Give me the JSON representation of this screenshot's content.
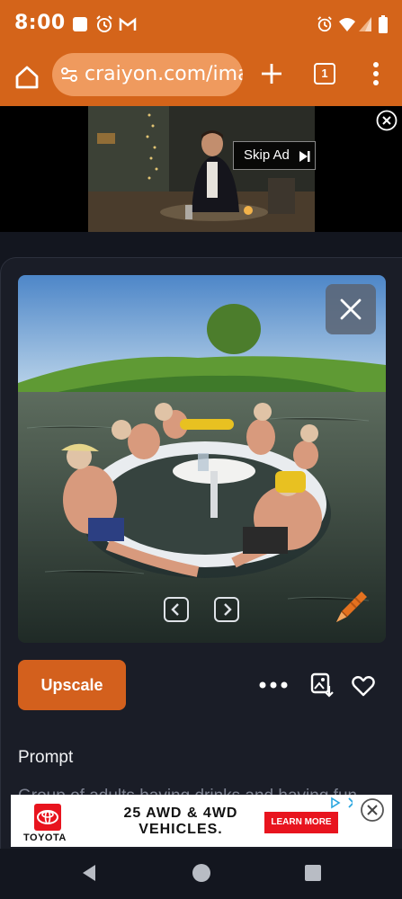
{
  "status_bar": {
    "time": "8:00",
    "left_icons": [
      "image-icon",
      "alarm-icon",
      "gmail-icon"
    ],
    "right_icons": [
      "alarm-icon",
      "wifi-icon",
      "signal-icon",
      "battery-icon"
    ]
  },
  "browser": {
    "url": "craiyon.com/ima",
    "tab_count": "1"
  },
  "top_ad": {
    "skip_label": "Skip Ad"
  },
  "card": {
    "upscale_label": "Upscale",
    "prompt_label": "Prompt",
    "prompt_text": "Group of adults having drinks and having fun"
  },
  "bottom_ad": {
    "brand": "TOYOTA",
    "headline": "25 AWD & 4WD VEHICLES.",
    "cta": "LEARN MORE"
  },
  "colors": {
    "brand_orange": "#d4641a",
    "background": "#13161f",
    "card": "#1a1d27"
  }
}
